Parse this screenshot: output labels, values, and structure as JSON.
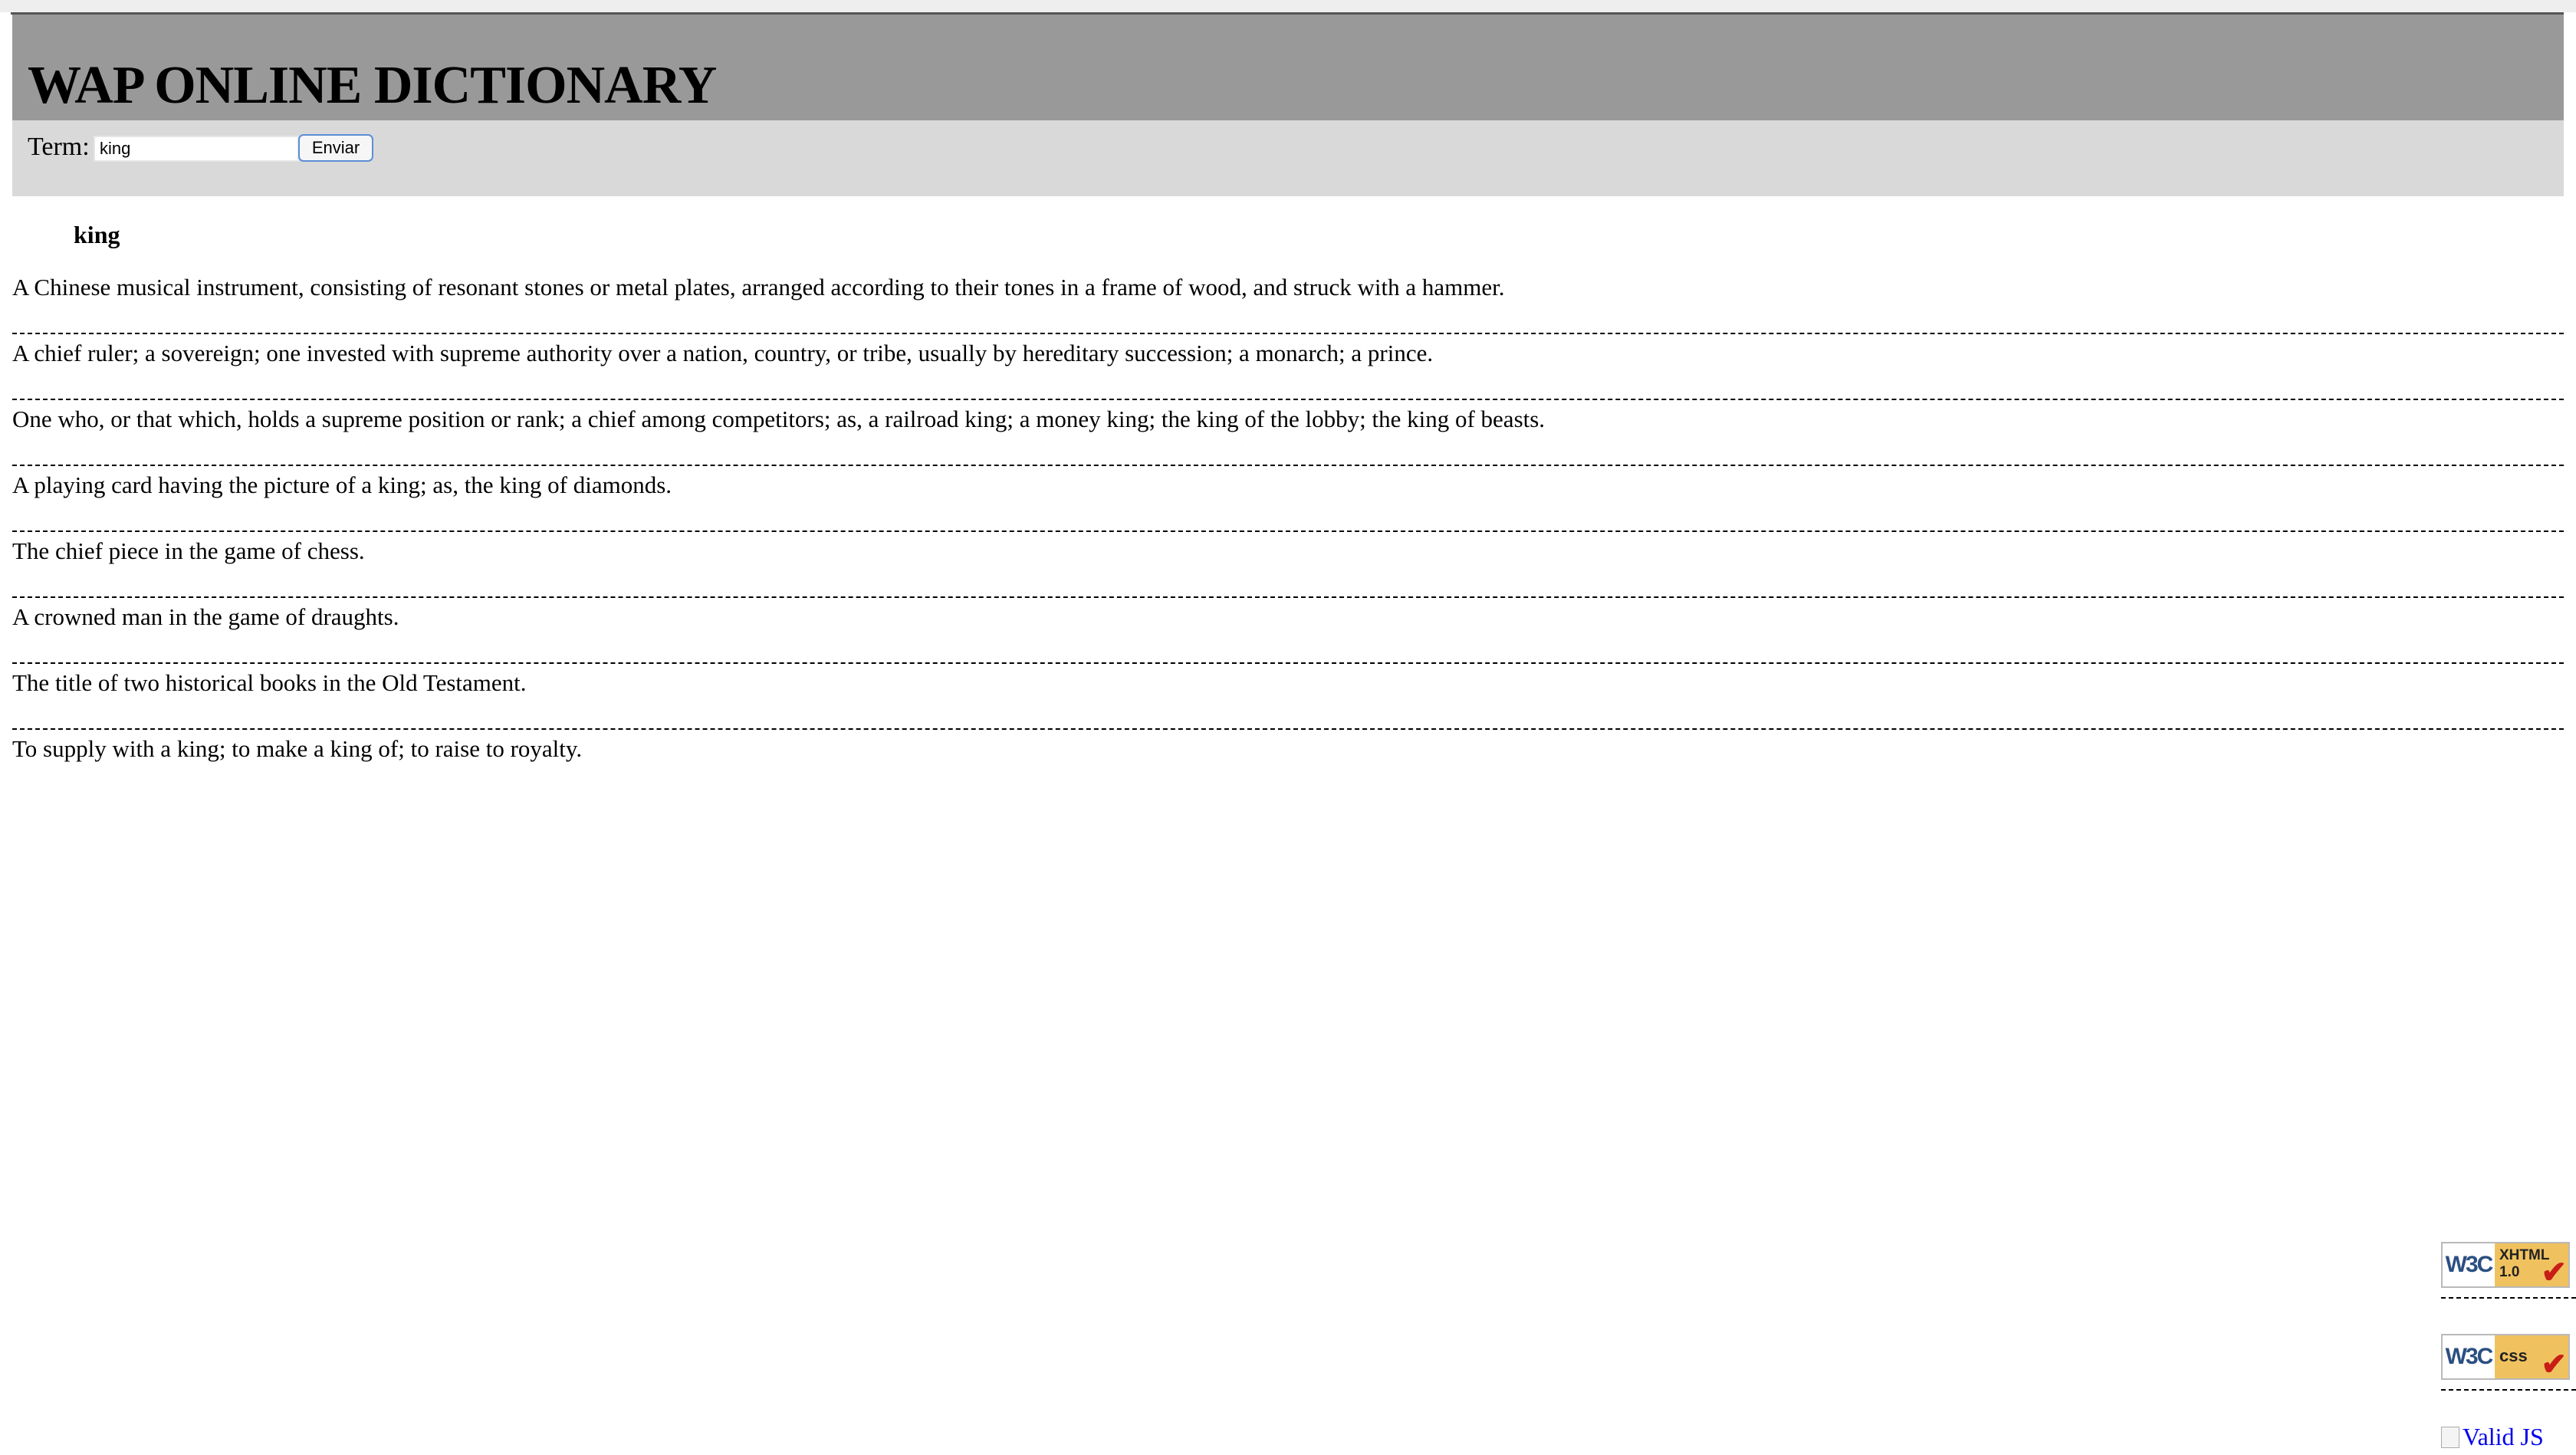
{
  "header": {
    "title": "WAP ONLINE DICTIONARY"
  },
  "search": {
    "label": "Term:",
    "value": "king",
    "submit_label": "Enviar"
  },
  "result": {
    "term": "king",
    "definitions": [
      "A Chinese musical instrument, consisting of resonant stones or metal plates, arranged according to their tones in a frame of wood, and struck with a hammer.",
      "A chief ruler; a sovereign; one invested with supreme authority over a nation, country, or tribe, usually by hereditary succession; a monarch; a prince.",
      "One who, or that which, holds a supreme position or rank; a chief among competitors; as, a railroad king; a money king; the king of the lobby; the king of beasts.",
      "A playing card having the picture of a king; as, the king of diamonds.",
      "The chief piece in the game of chess.",
      "A crowned man in the game of draughts.",
      "The title of two historical books in the Old Testament.",
      "To supply with a king; to make a king of; to raise to royalty."
    ]
  },
  "footer": {
    "badges": [
      {
        "logo": "W3C",
        "line1": "XHTML",
        "line2": "1.0"
      },
      {
        "logo": "W3C",
        "line1": "css",
        "line2": ""
      }
    ],
    "valid_js_alt": "Valid JS"
  },
  "colors": {
    "header_bg": "#999999",
    "searchbar_bg": "#d9d9d9",
    "link": "#0000ee",
    "badge_accent": "#f0c25f"
  }
}
